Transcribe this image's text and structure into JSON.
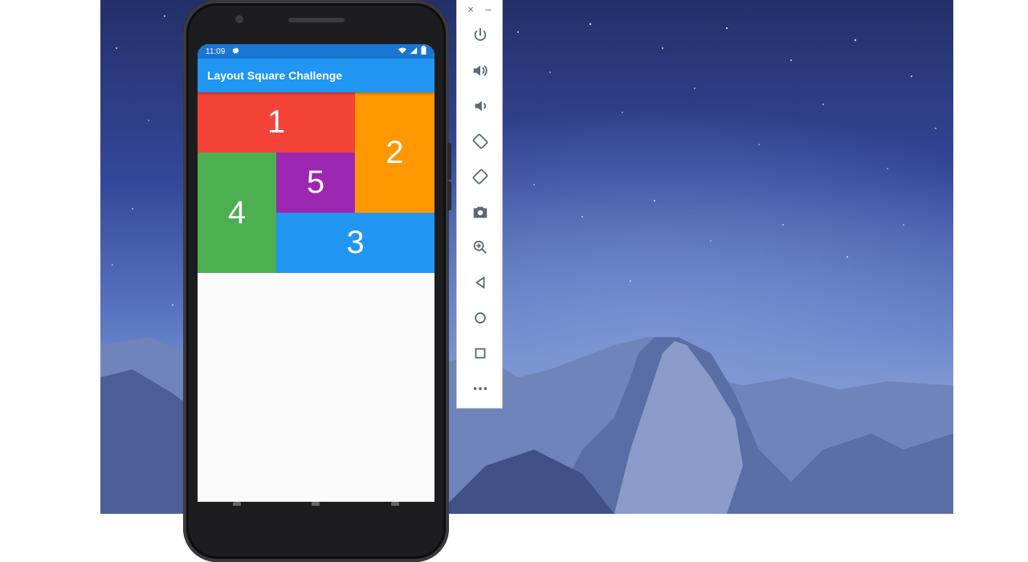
{
  "phone": {
    "status_bar": {
      "time": "11:09",
      "icons": [
        "gear-icon",
        "wifi-icon",
        "signal-icon",
        "battery-icon"
      ]
    },
    "app_bar": {
      "title": "Layout Square Challenge"
    },
    "tiles": [
      {
        "label": "1",
        "color": "#f44336"
      },
      {
        "label": "2",
        "color": "#ff9800"
      },
      {
        "label": "3",
        "color": "#2196f3"
      },
      {
        "label": "4",
        "color": "#4caf50"
      },
      {
        "label": "5",
        "color": "#9c27b0"
      }
    ]
  },
  "emulator_toolbar": {
    "window_controls": {
      "close": "×",
      "minimize": "–"
    },
    "buttons": [
      "power-icon",
      "volume-up-icon",
      "volume-down-icon",
      "rotate-left-icon",
      "rotate-right-icon",
      "camera-icon",
      "zoom-icon",
      "back-icon",
      "home-icon",
      "overview-icon",
      "more-icon"
    ]
  },
  "colors": {
    "status_bar": "#1976d2",
    "app_bar": "#2196f3",
    "toolbar_icon": "#5a6b74"
  }
}
